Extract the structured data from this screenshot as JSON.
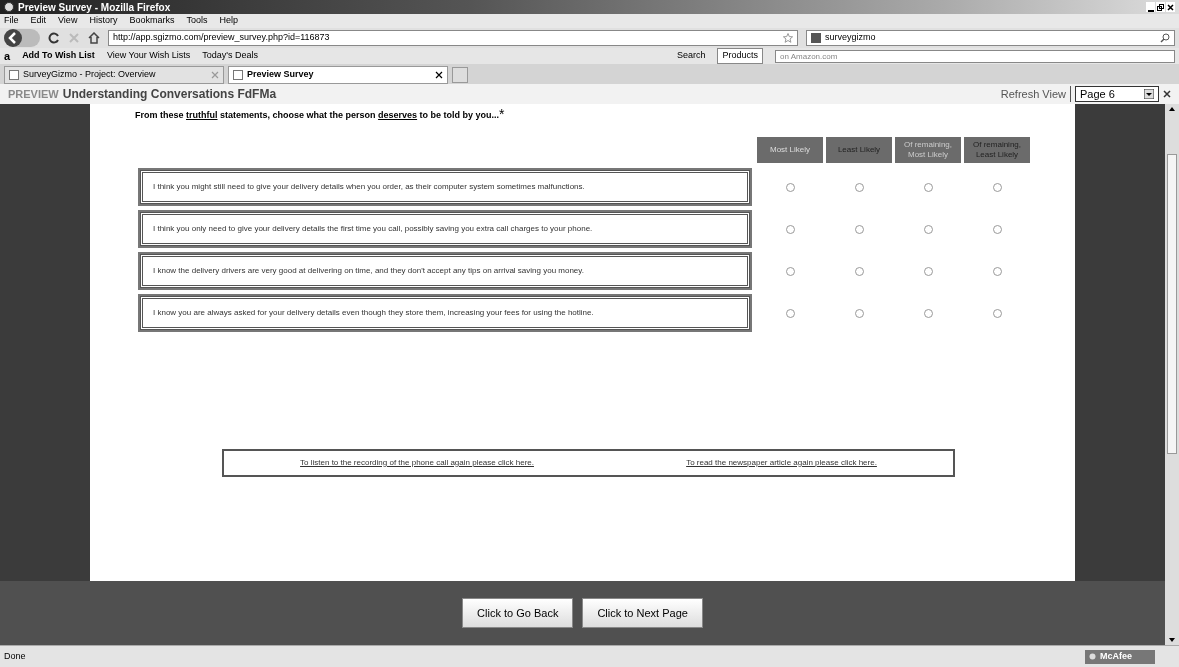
{
  "window": {
    "title": "Preview Survey - Mozilla Firefox"
  },
  "menu": [
    "File",
    "Edit",
    "View",
    "History",
    "Bookmarks",
    "Tools",
    "Help"
  ],
  "address_bar": {
    "value": "http://app.sgizmo.com/preview_survey.php?id=116873"
  },
  "search_box": {
    "value": "surveygizmo"
  },
  "amazon_toolbar": {
    "logo": "a",
    "items": [
      "Add To Wish List",
      "View Your Wish Lists",
      "Today's Deals"
    ],
    "search_label": "Search",
    "category": "Products",
    "placeholder": "on Amazon.com"
  },
  "tabs": [
    {
      "label": "SurveyGizmo - Project: Overview",
      "selected": false
    },
    {
      "label": "Preview Survey",
      "selected": true
    }
  ],
  "preview_bar": {
    "prefix": "PREVIEW",
    "title": "Understanding Conversations FdFMa",
    "refresh": "Refresh View",
    "page_select": "Page 6"
  },
  "question": {
    "parts": [
      {
        "text": "From these ",
        "underlined": false
      },
      {
        "text": "truthful",
        "underlined": true
      },
      {
        "text": " statements, choose what the person ",
        "underlined": false
      },
      {
        "text": "deserves",
        "underlined": true
      },
      {
        "text": " to be told by you...",
        "underlined": false
      }
    ],
    "required_mark": "*"
  },
  "columns": [
    "Most Likely",
    "Least Likely",
    "Of remaining, Most Likely",
    "Of remaining, Least Likely"
  ],
  "rows": [
    {
      "statement": "I think you might still need to give your delivery details when you order, as their computer system sometimes malfunctions.",
      "choices": [
        {
          "selected": false
        },
        {
          "selected": false
        },
        {
          "selected": false
        },
        {
          "selected": false
        }
      ]
    },
    {
      "statement": "I think you only need to give your delivery details the first time you call, possibly saving you extra call charges to your phone.",
      "choices": [
        {
          "selected": false
        },
        {
          "selected": false
        },
        {
          "selected": false
        },
        {
          "selected": false
        }
      ]
    },
    {
      "statement": "I know the delivery drivers are very good at delivering on time, and they don't accept any tips on arrival saving you money.",
      "choices": [
        {
          "selected": false
        },
        {
          "selected": false
        },
        {
          "selected": false
        },
        {
          "selected": false
        }
      ]
    },
    {
      "statement": "I know you are always asked for your delivery details even though they store them, increasing your fees for using the hotline.",
      "choices": [
        {
          "selected": false
        },
        {
          "selected": false
        },
        {
          "selected": false
        },
        {
          "selected": false
        }
      ]
    }
  ],
  "links": [
    "To listen to the recording of the phone call again please click here.",
    "To read the newspaper article again please click here."
  ],
  "buttons": [
    "Click to Go Back",
    "Click to Next Page"
  ],
  "status_bar": {
    "text": "Done",
    "addon": "McAfee"
  }
}
